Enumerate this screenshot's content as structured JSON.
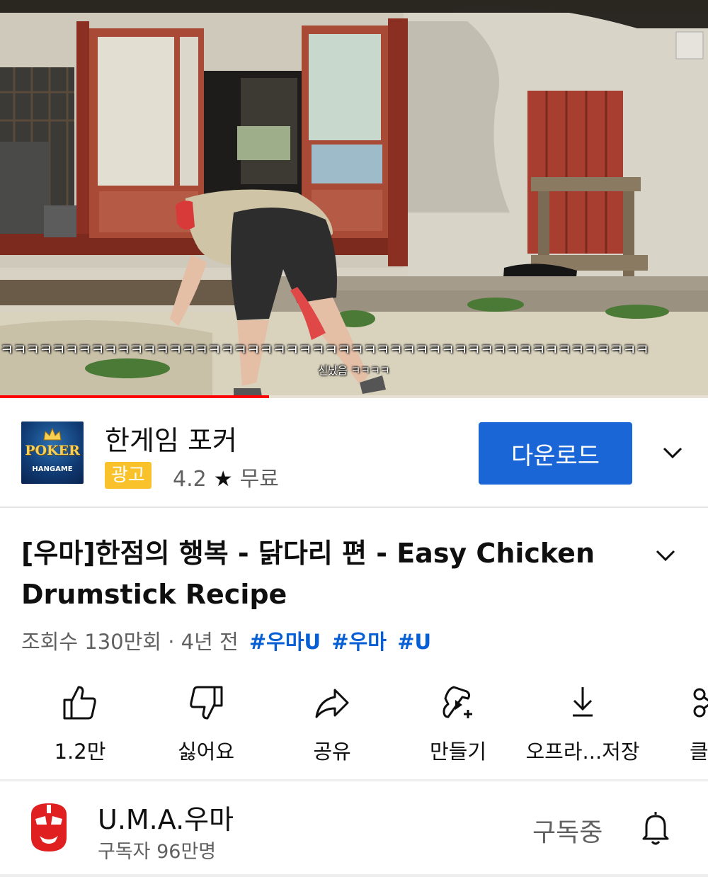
{
  "video": {
    "subtitle_line1": "ㅋㅋㅋㅋㅋㅋㅋㅋㅋㅋㅋㅋㅋㅋㅋㅋㅋㅋㅋㅋㅋㅋㅋㅋㅋㅋㅋㅋㅋㅋㅋㅋㅋㅋㅋㅋㅋㅋㅋㅋㅋㅋㅋㅋㅋㅋㅋㅋㅋㅋ",
    "subtitle_line2": "신났음 ㅋㅋㅋㅋ",
    "progress_fraction": 0.38,
    "progress_color": "#ff0000"
  },
  "ad": {
    "logo_text": "POKER",
    "logo_subtext": "HANGAME",
    "title": "한게임 포커",
    "badge": "광고",
    "rating": "4.2",
    "star": "★",
    "price": "무료",
    "button_label": "다운로드",
    "button_color": "#1a66d6",
    "badge_color": "#f9c22b",
    "expand_icon": "chevron-down-icon"
  },
  "video_info": {
    "title": "[우마]한점의 행복 - 닭다리 편 - Easy Chicken Drumstick Recipe",
    "views_time": "조회수 130만회 · 4년 전",
    "hashtags": [
      "#우마U",
      "#우마",
      "#U"
    ],
    "hashtag_color": "#065fd4",
    "expand_icon": "chevron-down-icon"
  },
  "actions": [
    {
      "icon": "thumbs-up-icon",
      "label": "1.2만"
    },
    {
      "icon": "thumbs-down-icon",
      "label": "싫어요"
    },
    {
      "icon": "share-icon",
      "label": "공유"
    },
    {
      "icon": "create-icon",
      "label": "만들기"
    },
    {
      "icon": "download-icon",
      "label": "오프라...저장"
    },
    {
      "icon": "clip-icon",
      "label": "클"
    }
  ],
  "channel": {
    "name": "U.M.A.우마",
    "subscribers": "구독자 96만명",
    "subscribe_state": "구독중",
    "bell_icon": "bell-icon"
  }
}
